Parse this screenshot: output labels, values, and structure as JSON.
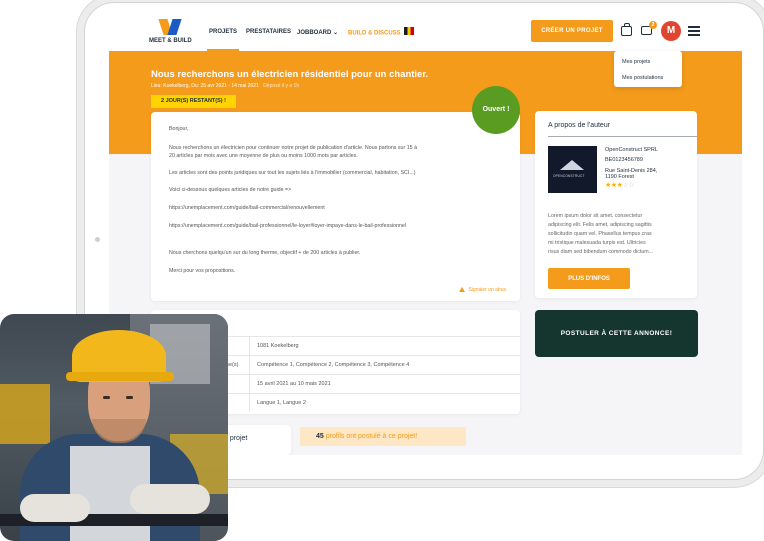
{
  "nav": {
    "logo_text": "MEET & BUILD",
    "items": [
      {
        "label": "PROJETS"
      },
      {
        "label": "PRESTATAIRES"
      },
      {
        "label": "JOBBOARD"
      },
      {
        "label": "BUILD & DISCUSS"
      }
    ],
    "create_project": "CRÉER UN PROJET",
    "notification_count": "2",
    "avatar_initial": "M"
  },
  "dropdown": {
    "items": [
      "Mes projets",
      "Mes postulations"
    ]
  },
  "hero": {
    "title": "Nous recherchons un électricien résidentiel pour un chantier.",
    "meta": "Lieu: Koekelberg, Du: 25 avr 2021 - 14 mai 2021",
    "posted": "Déposé il y a 1h",
    "days_left": "2 JOUR(S) RESTANT(S) !"
  },
  "status": {
    "label": "Ouvert !"
  },
  "description": {
    "lines": [
      "Bonjour,",
      "Nous recherchons un électricien pour continuer notre projet de publication d'article. Nous partons sur 15 à",
      "20 articles par mois avec une moyenne de plus ou moins 1000 mots par articles.",
      "Les articles sont des points juridiques sur tout les sujets liés à l'immobilier (commercial, habitation, SCI...)",
      "Voici ci-dessous quelques articles de notre guide =>",
      "https://unemplacement.com/guide/bail-commercial/renouvellement",
      "https://unemplacement.com/guide/bail-professionnel/le-loyer#loyer-impaye-dans-le-bail-professionnel",
      "Nous cherchons quelqu'un sur du long therme, objectif + de 200 articles à publier.",
      "Merci pour vos propositions."
    ],
    "report": "Signaler un abus"
  },
  "author": {
    "title": "A propos de l'auteur",
    "logo_label": "OPENCONSTRUCT",
    "name": "OpenConstruct SPRL",
    "vat": "BE0123456789",
    "address_1": "Rue Saint-Denis 284,",
    "address_2": "1190 Forest",
    "rating": 3,
    "rating_max": 5,
    "bio_lines": [
      "Lorem ipsum dolor sit amet, consectetur",
      "adipiscing elit. Felis amet, adipiscing sagittis",
      "sollicitudin quam vel. Phasellus tempus cras",
      "mi tristique malesuada turpis est. Ultricies",
      "risus diam sed bibendum commodo dictum..."
    ],
    "more_button": "PLUS D'INFOS"
  },
  "apply_button": "POSTULER À CETTE ANNONCE!",
  "details": {
    "header_fragment": "t",
    "rows": [
      {
        "key": "",
        "value": "1081 Koekelberg"
      },
      {
        "key": "ise(s)",
        "value": "Compétence 1, Compétence 2, Compétence 3, Compétence 4"
      },
      {
        "key": "",
        "value": "15 avril 2021 au 10 mais 2021"
      },
      {
        "key": "",
        "value": "Langue 1, Langue 2"
      }
    ]
  },
  "tab": {
    "label_fragment": "u projet"
  },
  "applied": {
    "count": "45",
    "text": "profils ont postulé à ce projet!"
  },
  "colors": {
    "accent": "#f49b1c",
    "dark_green": "#15352f",
    "status_green": "#5a9c22",
    "navy": "#1f2d3d"
  }
}
